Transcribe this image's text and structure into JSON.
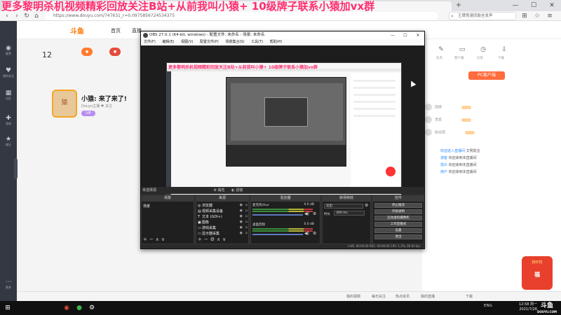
{
  "overlay": {
    "marquee": "更多黎明杀机视频精彩回放关注B站+从前我叫小猿+     10级牌子联系小猿加vx群"
  },
  "browser": {
    "address": "https://www.douyu.com/747631_r=0.0975856724534375",
    "search_placeholder": "王牌竞速同款全发声",
    "tab_new": "+",
    "ctrl_min": "—",
    "ctrl_max": "☐",
    "ctrl_close": "✕"
  },
  "site": {
    "logo": "斗鱼",
    "nav": [
      "首页",
      "直播"
    ],
    "hot_count": "12",
    "anchor_name": "小猿: 来了来了!",
    "anchor_sub": "Douyu主播 ♥ 关注",
    "vip": "VIP",
    "avatar_text": "猿",
    "sidebar": [
      "推荐",
      "我的关注",
      "分区",
      "游戏",
      "娱乐",
      "更多"
    ]
  },
  "right_panel": {
    "icons": [
      "任务",
      "客户端",
      "历史",
      "下载"
    ],
    "pc_button": "PC客户端",
    "ranks": [
      "周榜",
      "贵族",
      "粉丝团"
    ],
    "chat": [
      {
        "name": "欢迎进入直播间",
        "text": " 文明发言"
      },
      {
        "name": "游客",
        "text": " 欢迎来到本直播间"
      },
      {
        "name": "观众",
        "text": " 欢迎来到本直播间"
      },
      {
        "name": "用户",
        "text": " 欢迎来到本直播间"
      }
    ],
    "redbag_title": "抢红包",
    "redbag_amount": "福"
  },
  "bottom_strip": [
    "我的视频",
    "每日关注",
    "热点资讯",
    "我的直播",
    "下载"
  ],
  "obs": {
    "title": "OBS 27.0.1 (64-bit, windows) - 配置文件: 未命名 - 场景: 未命名",
    "menu": [
      "文件(F)",
      "编辑(E)",
      "视图(V)",
      "配置文件(P)",
      "场景集合(S)",
      "工具(T)",
      "帮助(H)"
    ],
    "dock_bar": [
      "未选择源",
      "⚙ 属性",
      "◐ 滤镜"
    ],
    "headers": {
      "scenes": "场景",
      "sources": "来源",
      "mixer": "混音器",
      "transitions": "转场特效",
      "controls": "控件"
    },
    "scene": "场景",
    "sources": [
      {
        "icon": "◎",
        "name": "浏览器"
      },
      {
        "icon": "▤",
        "name": "视频采集设备"
      },
      {
        "icon": "T",
        "name": "文本 (GDI+)"
      },
      {
        "icon": "▣",
        "name": "图像"
      },
      {
        "icon": "▭",
        "name": "游戏采集"
      },
      {
        "icon": "▭",
        "name": "显示器采集"
      }
    ],
    "mixer": [
      {
        "name": "麦克风/Aux",
        "db": "0.0 dB"
      },
      {
        "name": "桌面音频",
        "db": "0.0 dB"
      }
    ],
    "transition": {
      "type": "淡出",
      "duration_label": "时长",
      "duration": "300 ms"
    },
    "controls": [
      "停止推流",
      "开始录制",
      "启动虚拟摄像机",
      "工作室模式",
      "设置",
      "退出"
    ],
    "status": "LIVE: 00:00:00     REC: 00:00:00     CPU: 1.2%, 60.00 fps"
  },
  "preview": {
    "marquee": "更多黎明杀机视频精彩回放关注B站+从前我叫小猿+     10级牌子联系小猿加vx群"
  },
  "taskbar": {
    "start": "⊞",
    "apps": [
      "◉",
      "●",
      "⚙"
    ],
    "tray": "ENG",
    "time": "12:58 周一",
    "date": "2021/7/26"
  },
  "watermark": {
    "main": "斗鱼",
    "sub": "DOUYU.COM"
  }
}
